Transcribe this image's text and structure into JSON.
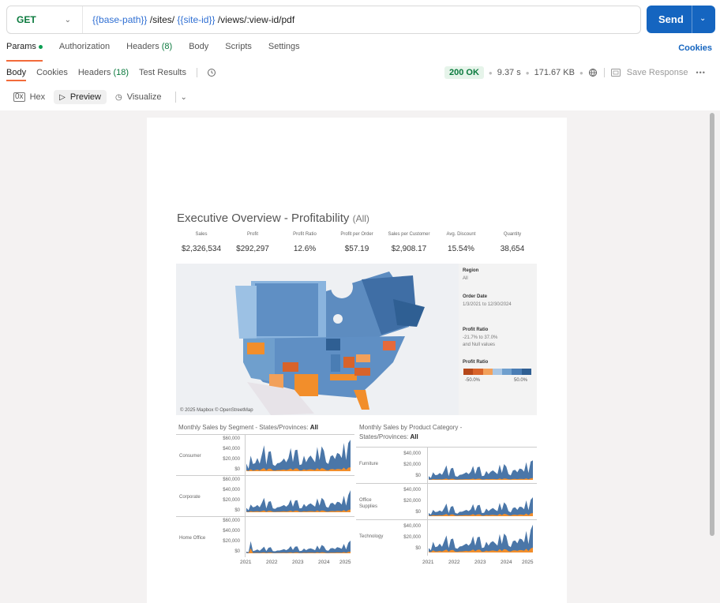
{
  "request": {
    "method": "GET",
    "url_parts": [
      {
        "text": "{{base-path}}",
        "var": true
      },
      {
        "text": " /sites/ ",
        "var": false
      },
      {
        "text": "{{site-id}}",
        "var": true
      },
      {
        "text": " /views/:view-id/pdf",
        "var": false
      }
    ],
    "send_label": "Send"
  },
  "request_tabs": [
    {
      "label": "Params",
      "dot": true,
      "count": "",
      "active": true
    },
    {
      "label": "Authorization",
      "dot": false,
      "count": "",
      "active": false
    },
    {
      "label": "Headers ",
      "dot": false,
      "count": "(8)",
      "active": false
    },
    {
      "label": "Body",
      "dot": false,
      "count": "",
      "active": false
    },
    {
      "label": "Scripts",
      "dot": false,
      "count": "",
      "active": false
    },
    {
      "label": "Settings",
      "dot": false,
      "count": "",
      "active": false
    }
  ],
  "cookies_link": "Cookies",
  "response_tabs": [
    {
      "label": "Body",
      "count": "",
      "active": true
    },
    {
      "label": "Cookies",
      "count": "",
      "active": false
    },
    {
      "label": "Headers ",
      "count": "(18)",
      "active": false
    },
    {
      "label": "Test Results",
      "count": "",
      "active": false
    }
  ],
  "response_meta": {
    "status": "200 OK",
    "time": "9.37 s",
    "size": "171.67 KB",
    "save_label": "Save Response"
  },
  "view_modes": [
    {
      "label": "Hex",
      "icon": "hex-icon",
      "active": false
    },
    {
      "label": "Preview",
      "icon": "play-icon",
      "active": true
    },
    {
      "label": "Visualize",
      "icon": "visualize-icon",
      "active": false
    }
  ],
  "dashboard": {
    "title": "Executive Overview - Profitability",
    "title_filter": "(All)",
    "kpis": [
      {
        "label": "Sales",
        "value": "$2,326,534"
      },
      {
        "label": "Profit",
        "value": "$292,297"
      },
      {
        "label": "Profit Ratio",
        "value": "12.6%"
      },
      {
        "label": "Profit per Order",
        "value": "$57.19"
      },
      {
        "label": "Sales per Customer",
        "value": "$2,908.17"
      },
      {
        "label": "Avg. Discount",
        "value": "15.54%"
      },
      {
        "label": "Quantity",
        "value": "38,654"
      }
    ],
    "map_credit": "© 2025 Mapbox © OpenStreetMap",
    "filters": {
      "region_title": "Region",
      "region_value": "All",
      "order_date_title": "Order Date",
      "order_date_value": "1/3/2021 to 12/30/2024",
      "profit_ratio_title": "Profit Ratio",
      "profit_ratio_value_1": "-21.7% to 37.0%",
      "profit_ratio_value_2": "and Null values",
      "legend_title": "Profit Ratio",
      "legend_min": "-50.0%",
      "legend_max": "50.0%",
      "legend_colors": [
        "#b5481a",
        "#d8632a",
        "#f2a05a",
        "#a8c6e4",
        "#6f9fcd",
        "#4a7db4",
        "#2f5f93"
      ]
    },
    "segment_section": {
      "title_prefix": "Monthly Sales by Segment - States/Provinces: ",
      "title_value": "All"
    },
    "category_section": {
      "title_line1": "Monthly Sales by Product Category -",
      "title_line2_prefix": "States/Provinces: ",
      "title_value": "All"
    },
    "colors": {
      "sales": "#4a76a8",
      "profit": "#f28e2b"
    }
  },
  "chart_data": [
    {
      "type": "area",
      "title": "Monthly Sales by Segment - States/Provinces: All",
      "x_ticks": [
        "2021",
        "2022",
        "2023",
        "2024",
        "2025"
      ],
      "series_names": [
        "Sales",
        "Profit"
      ],
      "panels": [
        {
          "name": "Consumer",
          "y_ticks": [
            "$60,000",
            "$40,000",
            "$20,000",
            "$0"
          ],
          "ylim": [
            0,
            60000
          ],
          "sales": [
            14000,
            4500,
            28000,
            13000,
            14500,
            24000,
            13500,
            30000,
            47000,
            12000,
            35000,
            36000,
            12000,
            9500,
            14500,
            15000,
            18000,
            23000,
            16000,
            24000,
            42000,
            16500,
            38000,
            39000,
            11000,
            12500,
            28000,
            16000,
            24000,
            28500,
            22000,
            16000,
            44000,
            20000,
            45000,
            37000,
            16000,
            13000,
            27000,
            29000,
            22000,
            33000,
            31000,
            24000,
            51000,
            20000,
            51000,
            57000
          ],
          "profit": [
            2000,
            500,
            3500,
            1200,
            2000,
            3000,
            1500,
            3800,
            5500,
            1500,
            4500,
            4500,
            1500,
            1000,
            2000,
            2000,
            2500,
            3000,
            2000,
            3000,
            5000,
            2000,
            4800,
            5000,
            1500,
            1500,
            3500,
            2000,
            3000,
            3500,
            2800,
            2000,
            5500,
            2500,
            5600,
            4500,
            2000,
            1600,
            3500,
            3800,
            2800,
            4200,
            4000,
            3000,
            6500,
            2500,
            6500,
            7000
          ]
        },
        {
          "name": "Corporate",
          "y_ticks": [
            "$60,000",
            "$40,000",
            "$20,000",
            "$0"
          ],
          "ylim": [
            0,
            60000
          ],
          "sales": [
            8000,
            3500,
            14000,
            9000,
            10000,
            13000,
            9000,
            17000,
            26000,
            7000,
            19000,
            20000,
            7000,
            6000,
            9000,
            9500,
            11000,
            13000,
            10000,
            14000,
            23000,
            10000,
            21000,
            22000,
            7000,
            7500,
            15000,
            10000,
            14000,
            16000,
            13000,
            10000,
            25000,
            12000,
            26000,
            22000,
            10000,
            8000,
            16000,
            17000,
            13000,
            19000,
            18000,
            14000,
            30000,
            12000,
            31000,
            40000
          ],
          "profit": [
            1200,
            400,
            2000,
            1100,
            1500,
            1800,
            1100,
            2200,
            3200,
            900,
            2400,
            2500,
            900,
            700,
            1200,
            1200,
            1500,
            1700,
            1300,
            1800,
            2900,
            1300,
            2700,
            2800,
            900,
            900,
            1900,
            1300,
            1800,
            2000,
            1700,
            1300,
            3200,
            1500,
            3300,
            2800,
            1300,
            1000,
            2000,
            2200,
            1700,
            2400,
            2300,
            1800,
            3800,
            1500,
            4000,
            5000
          ]
        },
        {
          "name": "Home Office",
          "y_ticks": [
            "$60,000",
            "$40,000",
            "$20,000",
            "$0"
          ],
          "ylim": [
            0,
            60000
          ],
          "sales": [
            3000,
            2000,
            22000,
            4000,
            5000,
            7000,
            4500,
            8000,
            12000,
            4000,
            10000,
            11000,
            4000,
            3500,
            5000,
            5000,
            6000,
            7500,
            5500,
            8000,
            13000,
            6000,
            12000,
            12500,
            4000,
            4500,
            8500,
            5500,
            8000,
            9000,
            7500,
            5500,
            14000,
            7000,
            15000,
            12500,
            5500,
            4500,
            9000,
            9500,
            7500,
            11000,
            10000,
            8000,
            17000,
            7000,
            19000,
            23000
          ],
          "profit": [
            500,
            300,
            9000,
            600,
            700,
            900,
            600,
            1000,
            1500,
            500,
            1300,
            1400,
            500,
            450,
            650,
            650,
            800,
            950,
            700,
            1000,
            1600,
            750,
            1500,
            1600,
            500,
            550,
            1100,
            700,
            1000,
            1100,
            950,
            700,
            1800,
            900,
            1900,
            1600,
            700,
            600,
            1150,
            1200,
            950,
            1400,
            1300,
            1000,
            2200,
            900,
            2400,
            2900
          ]
        }
      ]
    },
    {
      "type": "area",
      "title": "Monthly Sales by Product Category - States/Provinces: All",
      "x_ticks": [
        "2021",
        "2022",
        "2023",
        "2024",
        "2025"
      ],
      "series_names": [
        "Sales",
        "Profit"
      ],
      "panels": [
        {
          "name": "Furniture",
          "y_ticks": [
            "$40,000",
            "$20,000",
            "$0"
          ],
          "ylim": [
            0,
            45000
          ],
          "sales": [
            6000,
            3000,
            12000,
            7500,
            8000,
            11000,
            8000,
            15000,
            23000,
            6000,
            18000,
            19000,
            6000,
            5000,
            8000,
            8500,
            10000,
            12000,
            9000,
            13000,
            22000,
            9000,
            20000,
            21000,
            6000,
            6500,
            14000,
            9000,
            13000,
            15000,
            12000,
            9000,
            24000,
            11000,
            25000,
            21000,
            9000,
            7000,
            15000,
            16000,
            12000,
            18000,
            17000,
            13000,
            28000,
            11000,
            29000,
            31000
          ],
          "profit": [
            600,
            300,
            1200,
            700,
            800,
            1000,
            800,
            1400,
            2000,
            600,
            1600,
            1700,
            600,
            500,
            800,
            800,
            900,
            1100,
            900,
            1200,
            1900,
            900,
            1800,
            1900,
            600,
            650,
            1300,
            900,
            1200,
            1400,
            1100,
            900,
            2100,
            1000,
            2200,
            1900,
            900,
            700,
            1400,
            1500,
            1100,
            1600,
            1500,
            1200,
            2400,
            1000,
            2500,
            2700
          ]
        },
        {
          "name": "Office Supplies",
          "y_ticks": [
            "$40,000",
            "$20,000",
            "$0"
          ],
          "ylim": [
            0,
            45000
          ],
          "sales": [
            5000,
            2500,
            10000,
            6500,
            7000,
            9000,
            7000,
            13000,
            20000,
            5000,
            15000,
            16000,
            5000,
            4000,
            7000,
            7000,
            8500,
            10000,
            8000,
            11000,
            19000,
            8000,
            17000,
            18000,
            5000,
            5500,
            12000,
            8000,
            11000,
            13000,
            10000,
            8000,
            21000,
            9500,
            22000,
            18000,
            8000,
            6000,
            13000,
            14000,
            10000,
            15000,
            14500,
            11000,
            25000,
            9500,
            26000,
            30000
          ],
          "profit": [
            900,
            450,
            1800,
            1100,
            1200,
            1600,
            1200,
            2200,
            3400,
            900,
            2600,
            2800,
            900,
            700,
            1200,
            1200,
            1500,
            1800,
            1400,
            1900,
            3200,
            1400,
            2900,
            3000,
            900,
            950,
            2000,
            1400,
            1900,
            2200,
            1800,
            1400,
            3600,
            1600,
            3700,
            3100,
            1400,
            1050,
            2200,
            2400,
            1800,
            2600,
            2500,
            1900,
            4200,
            1600,
            4400,
            5000
          ]
        },
        {
          "name": "Technology",
          "y_ticks": [
            "$40,000",
            "$20,000",
            "$0"
          ],
          "ylim": [
            0,
            45000
          ],
          "sales": [
            7000,
            3500,
            17000,
            8500,
            9500,
            14000,
            9000,
            18000,
            27000,
            7000,
            21000,
            22000,
            7000,
            6000,
            9500,
            10000,
            12000,
            14000,
            11000,
            15000,
            26000,
            11000,
            24000,
            25000,
            7000,
            8000,
            17000,
            11000,
            16000,
            18000,
            14500,
            11000,
            29000,
            13500,
            30000,
            26000,
            11000,
            8500,
            18000,
            19000,
            14500,
            22000,
            21000,
            16000,
            34000,
            13500,
            36000,
            44000
          ],
          "profit": [
            1300,
            600,
            3500,
            1500,
            1700,
            2500,
            1600,
            3200,
            4800,
            1300,
            3800,
            4000,
            1300,
            1100,
            1700,
            1800,
            2200,
            2600,
            2000,
            2700,
            4600,
            2000,
            4300,
            4500,
            1300,
            1450,
            3000,
            2000,
            2900,
            3200,
            2600,
            2000,
            5200,
            2400,
            5400,
            4600,
            2000,
            1500,
            3200,
            3400,
            2600,
            3900,
            3700,
            2900,
            6000,
            2400,
            6400,
            7800
          ]
        }
      ]
    }
  ]
}
